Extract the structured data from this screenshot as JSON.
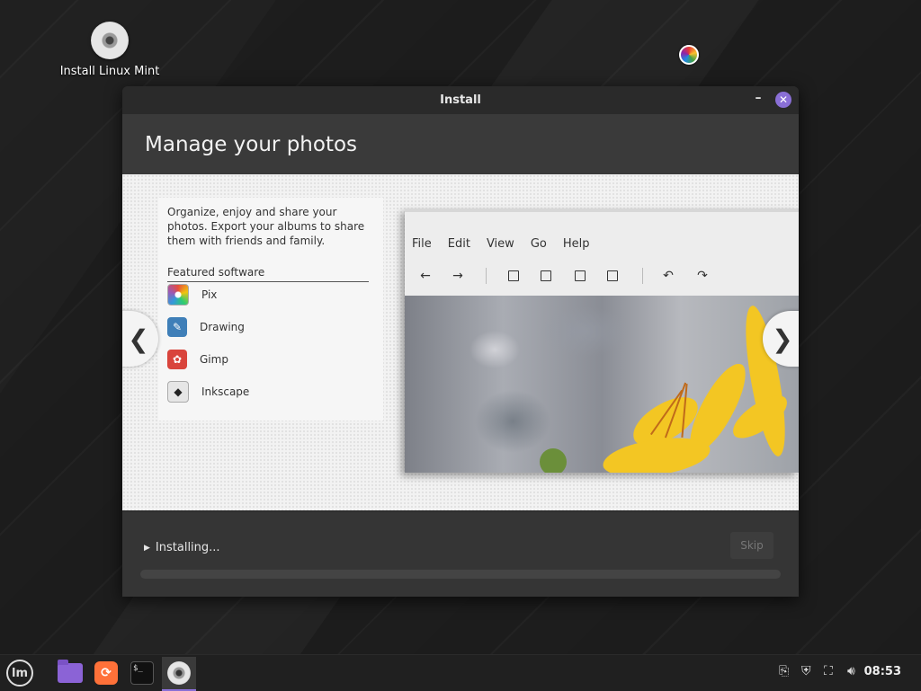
{
  "desktop": {
    "icon_label": "Install Linux Mint"
  },
  "window": {
    "title": "Install",
    "slide_title": "Manage your photos",
    "description": "Organize, enjoy and share your photos. Export your albums to share them with friends and family.",
    "featured_heading": "Featured software",
    "apps": [
      {
        "name": "Pix",
        "icon": "pix-icon"
      },
      {
        "name": "Drawing",
        "icon": "drawing-icon"
      },
      {
        "name": "Gimp",
        "icon": "gimp-icon"
      },
      {
        "name": "Inkscape",
        "icon": "inkscape-icon"
      }
    ],
    "screenshot_menu": [
      "File",
      "Edit",
      "View",
      "Go",
      "Help"
    ],
    "status_text": "Installing...",
    "skip_label": "Skip",
    "progress": 0.0
  },
  "taskbar": {
    "clock": "08:53"
  },
  "colors": {
    "accent": "#8a6fd6",
    "header_bg": "#3a3a3a",
    "footer_bg": "#353535"
  }
}
